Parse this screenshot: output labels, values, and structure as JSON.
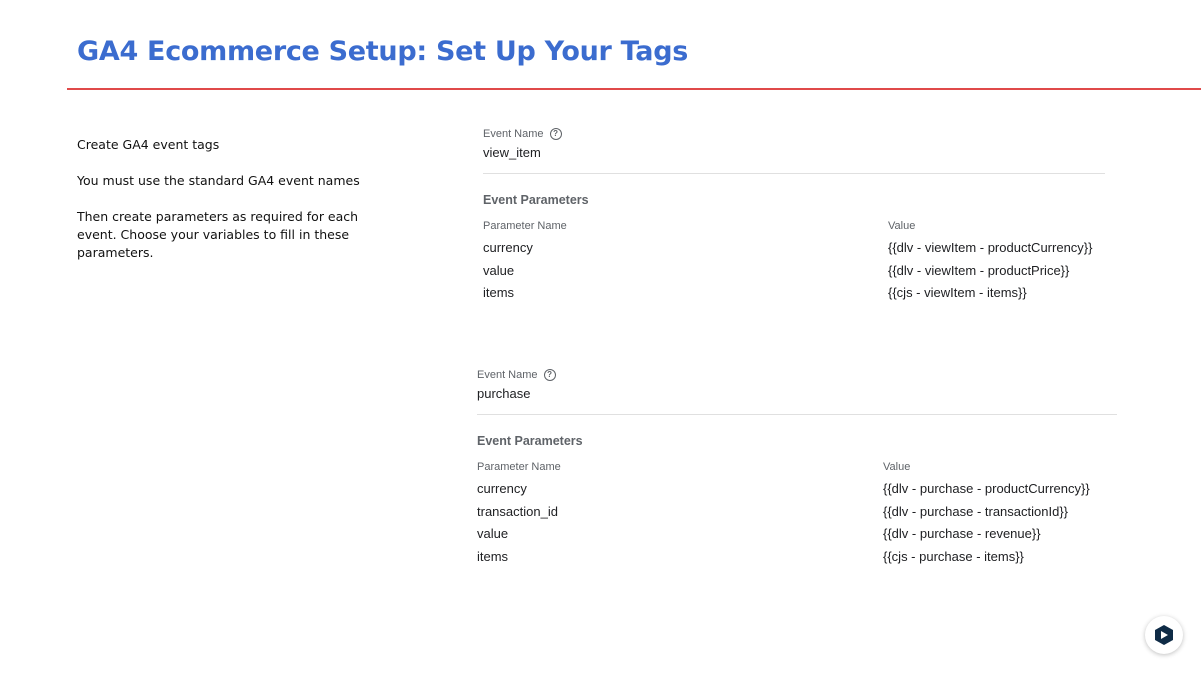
{
  "slide": {
    "title": "GA4 Ecommerce Setup: Set Up Your Tags",
    "instructions": [
      "Create GA4 event tags",
      "You must use the standard GA4 event names",
      "Then create parameters as required for each event. Choose your variables to fill in these parameters."
    ]
  },
  "tags": [
    {
      "event_name_label": "Event Name",
      "event_name": "view_item",
      "params_heading": "Event Parameters",
      "col_param": "Parameter Name",
      "col_value": "Value",
      "params": [
        {
          "name": "currency",
          "value": "{{dlv - viewItem - productCurrency}}"
        },
        {
          "name": "value",
          "value": "{{dlv - viewItem - productPrice}}"
        },
        {
          "name": "items",
          "value": "{{cjs - viewItem - items}}"
        }
      ]
    },
    {
      "event_name_label": "Event Name",
      "event_name": "purchase",
      "params_heading": "Event Parameters",
      "col_param": "Parameter Name",
      "col_value": "Value",
      "params": [
        {
          "name": "currency",
          "value": "{{dlv - purchase - productCurrency}}"
        },
        {
          "name": "transaction_id",
          "value": "{{dlv - purchase - transactionId}}"
        },
        {
          "name": "value",
          "value": "{{dlv - purchase - revenue}}"
        },
        {
          "name": "items",
          "value": "{{cjs - purchase - items}}"
        }
      ]
    }
  ],
  "icons": {
    "help": "help-circle-icon",
    "fab": "assistant-logo-icon"
  },
  "colors": {
    "title": "#3b6ccf",
    "rule": "#e04a4a"
  }
}
